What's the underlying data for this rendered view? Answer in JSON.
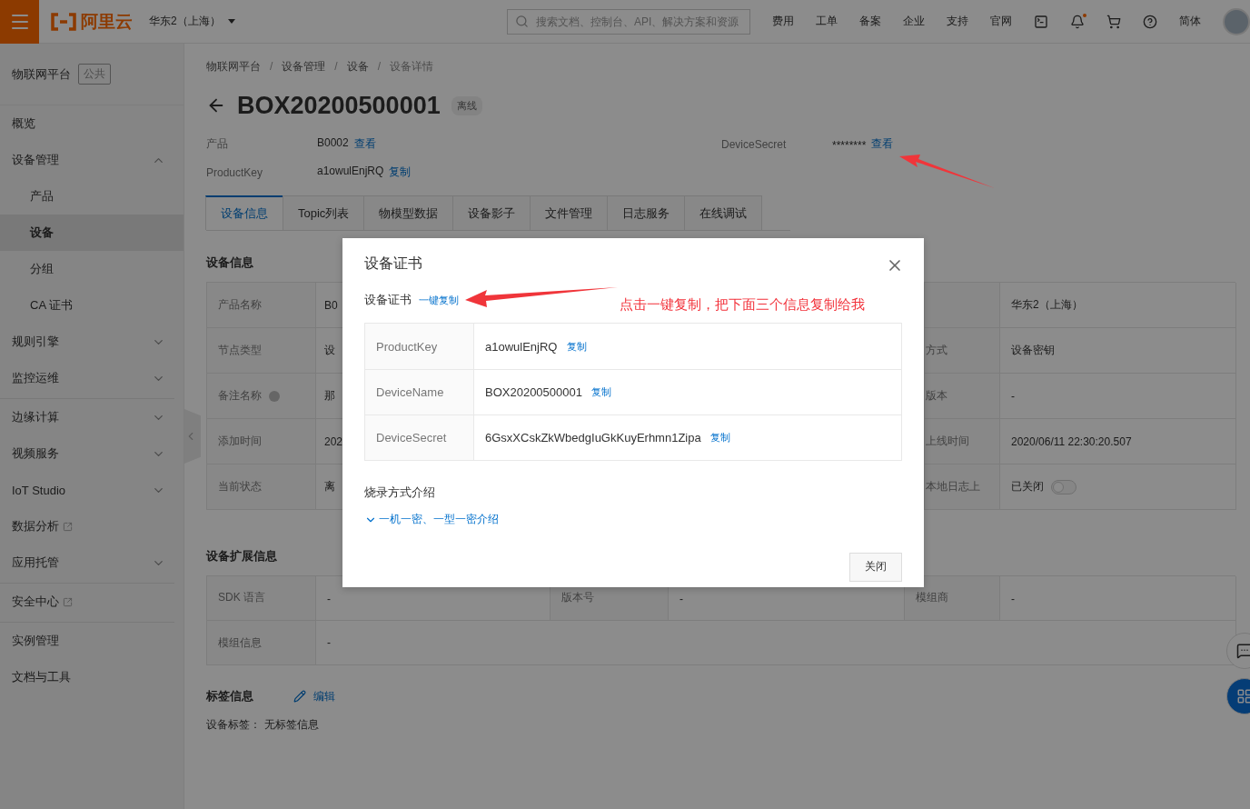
{
  "topbar": {
    "logo_text": "阿里云",
    "region": "华东2（上海）",
    "search": {
      "placeholder": "搜索文档、控制台、API、解决方案和资源"
    },
    "nav": [
      "费用",
      "工单",
      "备案",
      "企业",
      "支持",
      "官网"
    ],
    "notification_dot": true,
    "language": "简体"
  },
  "sidebar": {
    "title": "物联网平台",
    "badge": "公共",
    "groups": [
      {
        "items": [
          {
            "label": "概览",
            "kind": "plain",
            "selected": false
          },
          {
            "label": "设备管理",
            "kind": "expandable",
            "expanded": true,
            "selected": false,
            "children": [
              {
                "label": "产品",
                "selected": false
              },
              {
                "label": "设备",
                "selected": true
              },
              {
                "label": "分组",
                "selected": false
              },
              {
                "label": "CA 证书",
                "selected": false
              }
            ]
          },
          {
            "label": "规则引擎",
            "kind": "expandable",
            "expanded": false,
            "selected": false
          },
          {
            "label": "监控运维",
            "kind": "expandable",
            "expanded": false,
            "selected": false
          }
        ]
      },
      {
        "items": [
          {
            "label": "边缘计算",
            "kind": "expandable",
            "expanded": false,
            "selected": false
          },
          {
            "label": "视频服务",
            "kind": "expandable",
            "expanded": false,
            "selected": false
          },
          {
            "label": "IoT Studio",
            "kind": "expandable",
            "expanded": false,
            "selected": false
          },
          {
            "label": "数据分析",
            "kind": "external",
            "selected": false
          },
          {
            "label": "应用托管",
            "kind": "expandable",
            "expanded": false,
            "selected": false
          }
        ]
      },
      {
        "items": [
          {
            "label": "安全中心",
            "kind": "external",
            "selected": false
          }
        ]
      },
      {
        "items": [
          {
            "label": "实例管理",
            "kind": "plain",
            "selected": false
          },
          {
            "label": "文档与工具",
            "kind": "plain",
            "selected": false
          }
        ]
      }
    ]
  },
  "breadcrumb": {
    "items": [
      "物联网平台",
      "设备管理",
      "设备",
      "设备详情"
    ],
    "separator": "/"
  },
  "device": {
    "name": "BOX20200500001",
    "status": "离线"
  },
  "summary": [
    {
      "label": "产品",
      "value": "B0002",
      "action": "查看"
    },
    {
      "label": "DeviceSecret",
      "value": "********",
      "action": "查看"
    },
    {
      "label": "ProductKey",
      "value": "a1owulEnjRQ",
      "action": "复制"
    }
  ],
  "tabs": [
    {
      "label": "设备信息",
      "selected": true
    },
    {
      "label": "Topic列表",
      "selected": false
    },
    {
      "label": "物模型数据",
      "selected": false
    },
    {
      "label": "设备影子",
      "selected": false
    },
    {
      "label": "文件管理",
      "selected": false
    },
    {
      "label": "日志服务",
      "selected": false
    },
    {
      "label": "在线调试",
      "selected": false
    }
  ],
  "info": {
    "title": "设备信息",
    "rows": [
      {
        "label": "产品名称",
        "value": "B0",
        "value_2": "华东2（上海）"
      },
      {
        "label": "节点类型",
        "value": "设",
        "label_2": "方式",
        "value_2": "设备密钥"
      },
      {
        "label": "备注名称",
        "help": true,
        "value": "那",
        "label_2": "版本",
        "value_2": "-"
      },
      {
        "label": "添加时间",
        "value": "202",
        "label_2": "上线时间",
        "value_2": "2020/06/11 22:30:20.507"
      },
      {
        "label": "当前状态",
        "value": "离",
        "label_2": "本地日志上",
        "value_2": "已关闭",
        "switch_on": false
      }
    ]
  },
  "extension": {
    "title": "设备扩展信息",
    "rows": [
      {
        "cells": [
          "SDK 语言",
          "-",
          "版本号",
          "-",
          "模组商",
          "-"
        ]
      },
      {
        "cells": [
          "模组信息",
          "-"
        ]
      }
    ]
  },
  "tags": {
    "title": "标签信息",
    "edit": "编辑",
    "label": "设备标签：",
    "value": "无标签信息"
  },
  "dialog": {
    "title": "设备证书",
    "cert_label": "设备证书",
    "copy_all": "一键复制",
    "rows": [
      {
        "key": "ProductKey",
        "value": "a1owulEnjRQ",
        "copy": "复制"
      },
      {
        "key": "DeviceName",
        "value": "BOX20200500001",
        "copy": "复制"
      },
      {
        "key": "DeviceSecret",
        "value": "6GsxXCskZkWbedgIuGkKuyErhmn1Zipa",
        "copy": "复制"
      }
    ],
    "burn_title": "烧录方式介绍",
    "burn_link": "一机一密、一型一密介绍",
    "close_button": "关闭"
  },
  "annotation": {
    "text": "点击一键复制，把下面三个信息复制给我"
  }
}
